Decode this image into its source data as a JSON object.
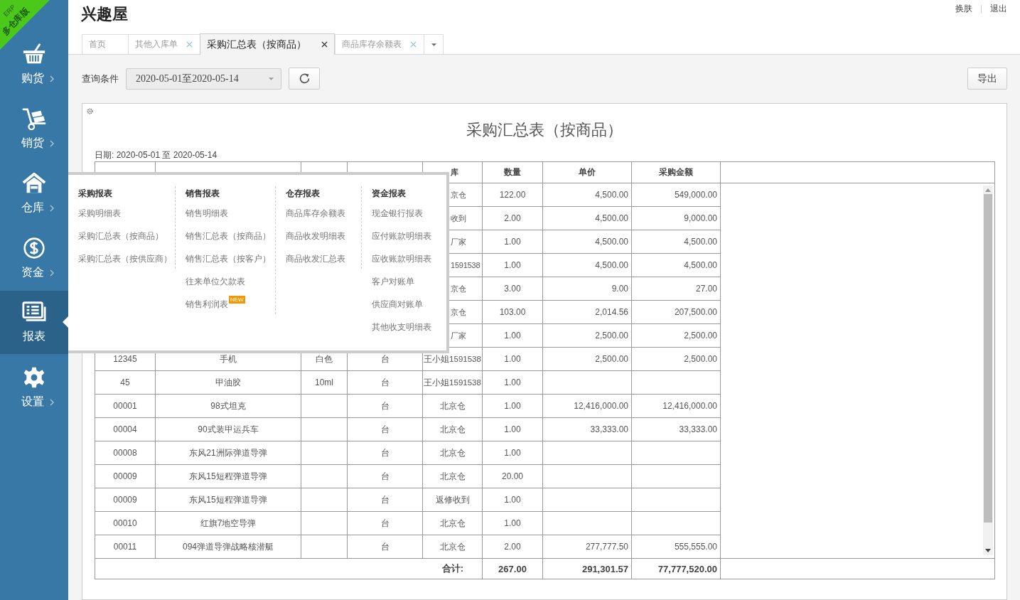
{
  "edition_ribbon": {
    "line_1": "ERP",
    "line_2": "多仓库版"
  },
  "sidebar": {
    "items": [
      {
        "label": "购货",
        "selected": false
      },
      {
        "label": "销货",
        "selected": false
      },
      {
        "label": "仓库",
        "selected": false
      },
      {
        "label": "资金",
        "selected": false
      },
      {
        "label": "报表",
        "selected": true
      },
      {
        "label": "设置",
        "selected": false
      }
    ]
  },
  "app_title": "兴趣屋",
  "top_links": [
    "换肤",
    "退出"
  ],
  "tabs": [
    {
      "label": "首页",
      "selected": false,
      "closable": false
    },
    {
      "label": "其他入库单",
      "selected": false,
      "closable": true
    },
    {
      "label": "采购汇总表（按商品）",
      "selected": true,
      "closable": true
    },
    {
      "label": "商品库存余额表",
      "selected": false,
      "closable": true
    }
  ],
  "toolbar": {
    "filter_label": "查询条件",
    "date_range": "2020-05-01至2020-05-14",
    "export_button": "导出"
  },
  "report": {
    "title": "采购汇总表（按商品）",
    "date_line": "日期: 2020-05-01 至 2020-05-14",
    "columns": [
      "库",
      "数量",
      "单价",
      "采购金额"
    ],
    "rows": [
      {
        "kind": "covered",
        "warehouse": "京仓",
        "qty": "122.00",
        "price": "4,500.00",
        "amount": "549,000.00"
      },
      {
        "kind": "covered",
        "warehouse": "收到",
        "qty": "2.00",
        "price": "4,500.00",
        "amount": "9,000.00"
      },
      {
        "kind": "covered",
        "warehouse": "厂家",
        "qty": "1.00",
        "price": "4,500.00",
        "amount": "4,500.00"
      },
      {
        "kind": "covered",
        "warehouse": "1591538",
        "qty": "1.00",
        "price": "4,500.00",
        "amount": "4,500.00"
      },
      {
        "kind": "covered",
        "warehouse": "京仓",
        "qty": "3.00",
        "price": "9.00",
        "amount": "27.00"
      },
      {
        "kind": "covered",
        "warehouse": "京仓",
        "qty": "103.00",
        "price": "2,014.56",
        "amount": "207,500.00"
      },
      {
        "kind": "covered",
        "warehouse": "厂家",
        "qty": "1.00",
        "price": "2,500.00",
        "amount": "2,500.00"
      },
      {
        "kind": "full",
        "code": "12345",
        "name": "手机",
        "spec": "白色",
        "unit": "台",
        "warehouse": "王小姐1591538",
        "qty": "1.00",
        "price": "2,500.00",
        "amount": "2,500.00"
      },
      {
        "kind": "full",
        "code": "45",
        "name": "甲油胶",
        "spec": "10ml",
        "unit": "台",
        "warehouse": "王小姐1591538",
        "qty": "1.00"
      },
      {
        "kind": "full",
        "code": "00001",
        "name": "98式坦克",
        "unit": "台",
        "warehouse": "北京仓",
        "qty": "1.00",
        "price": "12,416,000.00",
        "amount": "12,416,000.00"
      },
      {
        "kind": "full",
        "code": "00004",
        "name": "90式装甲运兵车",
        "unit": "台",
        "warehouse": "北京仓",
        "qty": "1.00",
        "price": "33,333.00",
        "amount": "33,333.00"
      },
      {
        "kind": "full",
        "code": "00008",
        "name": "东风21洲际弹道导弹",
        "unit": "台",
        "warehouse": "北京仓",
        "qty": "1.00"
      },
      {
        "kind": "full",
        "code": "00009",
        "name": "东风15短程弹道导弹",
        "unit": "台",
        "warehouse": "北京仓",
        "qty": "20.00"
      },
      {
        "kind": "full",
        "code": "00009",
        "name": "东风15短程弹道导弹",
        "unit": "台",
        "warehouse": "返修收到",
        "qty": "1.00"
      },
      {
        "kind": "full",
        "code": "00010",
        "name": "红旗7地空导弹",
        "unit": "台",
        "warehouse": "北京仓",
        "qty": "1.00"
      },
      {
        "kind": "full",
        "code": "00011",
        "name": "094弹道导弹战略核潜艇",
        "unit": "台",
        "warehouse": "北京仓",
        "qty": "2.00",
        "price": "277,777.50",
        "amount": "555,555.00"
      }
    ],
    "total": {
      "label": "合计:",
      "qty": "267.00",
      "price": "291,301.57",
      "amount": "77,777,520.00"
    }
  },
  "report_menu": {
    "sections": [
      {
        "heading": "采购报表",
        "items": [
          {
            "label": "采购明细表"
          },
          {
            "label": "采购汇总表（按商品）"
          },
          {
            "label": "采购汇总表（按供应商）"
          }
        ]
      },
      {
        "heading": "销售报表",
        "items": [
          {
            "label": "销售明细表"
          },
          {
            "label": "销售汇总表（按商品）"
          },
          {
            "label": "销售汇总表（按客户）"
          },
          {
            "label": "往来单位欠款表"
          },
          {
            "label": "销售利润表",
            "badge": "NEW"
          }
        ]
      },
      {
        "heading": "仓存报表",
        "items": [
          {
            "label": "商品库存余额表"
          },
          {
            "label": "商品收发明细表"
          },
          {
            "label": "商品收发汇总表"
          }
        ]
      },
      {
        "heading": "资金报表",
        "items": [
          {
            "label": "现金银行报表"
          },
          {
            "label": "应付账款明细表"
          },
          {
            "label": "应收账款明细表"
          },
          {
            "label": "客户对账单"
          },
          {
            "label": "供应商对账单"
          },
          {
            "label": "其他收支明细表"
          }
        ]
      }
    ]
  }
}
